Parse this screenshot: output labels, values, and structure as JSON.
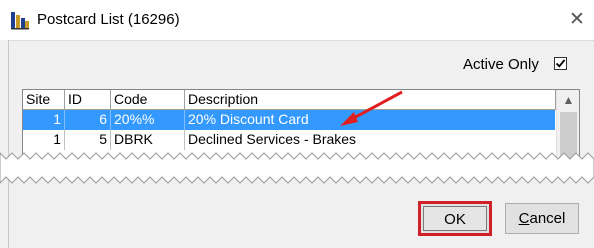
{
  "window": {
    "title": "Postcard List (16296)",
    "close_glyph": "✕"
  },
  "filter": {
    "active_only_label": "Active Only",
    "active_only_checked": true
  },
  "grid": {
    "columns": [
      "Site",
      "ID",
      "Code",
      "Description"
    ],
    "rows": [
      {
        "site": "1",
        "id": "6",
        "code": "20%%",
        "description": "20% Discount Card",
        "selected": true
      },
      {
        "site": "1",
        "id": "5",
        "code": "DBRK",
        "description": "Declined Services - Brakes",
        "selected": false
      }
    ]
  },
  "buttons": {
    "ok_label": "OK",
    "cancel_first": "C",
    "cancel_rest": "ancel"
  },
  "colors": {
    "selection": "#3399ff",
    "highlight": "#d0202a"
  }
}
